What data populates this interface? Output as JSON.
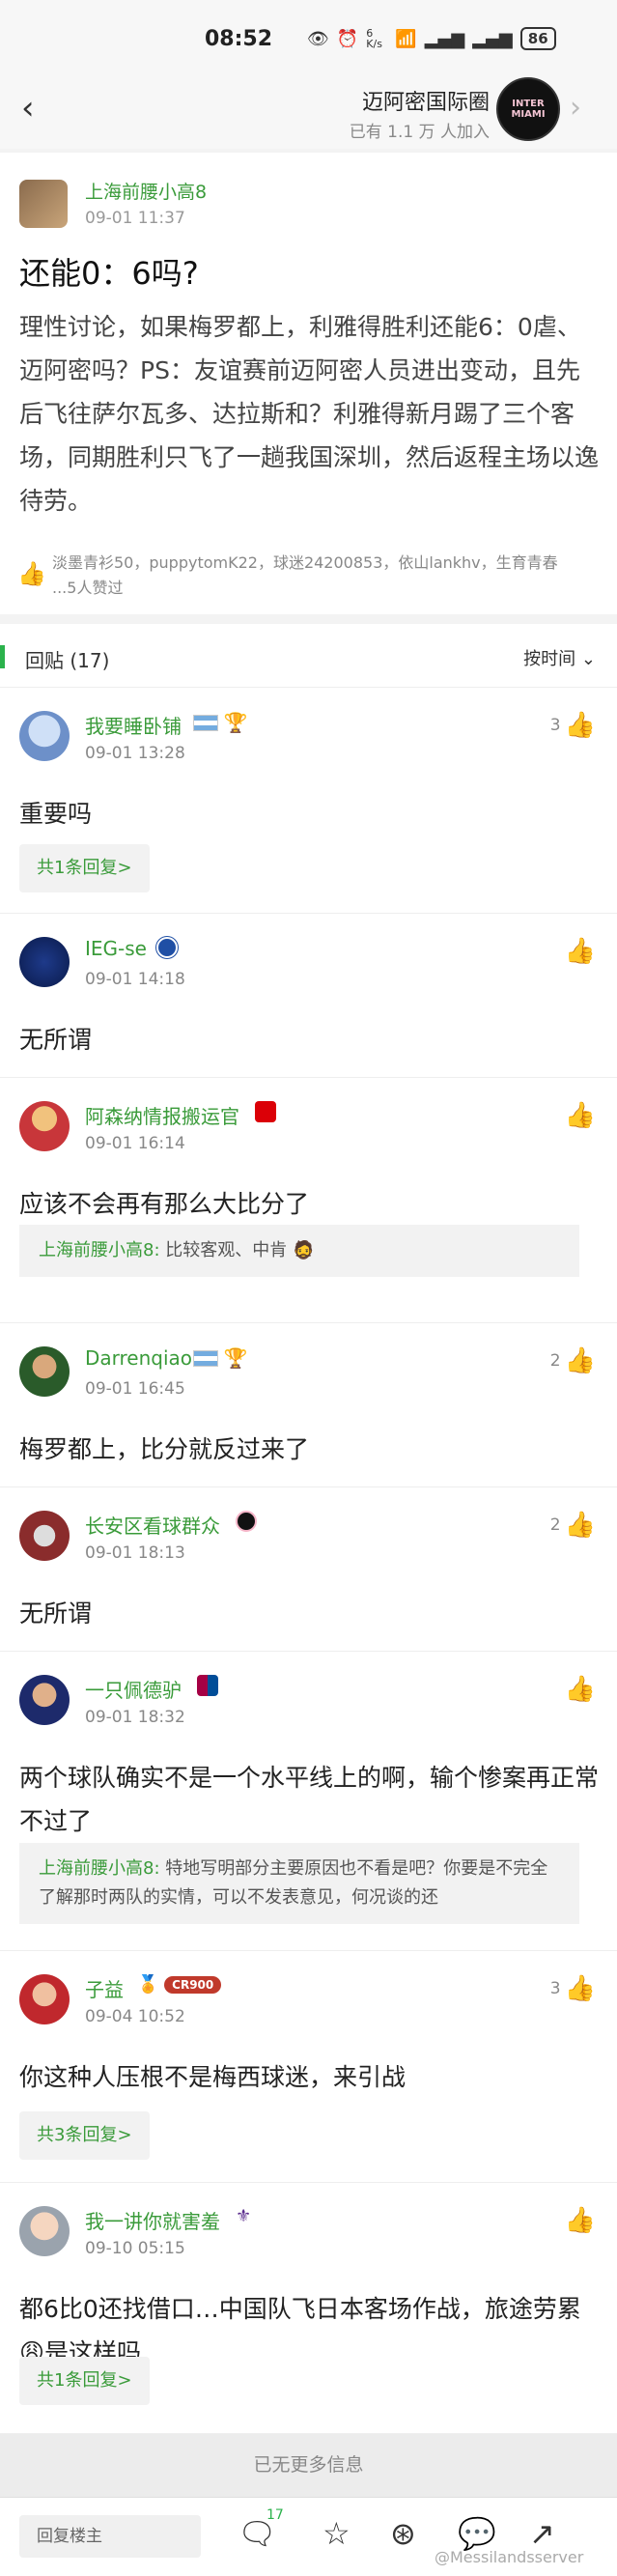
{
  "status_bar": {
    "time": "08:52",
    "network_speed": "6 K/s",
    "battery": "86"
  },
  "header": {
    "back_icon": "chevron-left-icon",
    "circle_name": "迈阿密国际圈",
    "members": "已有 1.1 万 人加入",
    "logo_text": "INTER MIAMI"
  },
  "post": {
    "author": "上海前腰小高8",
    "time": "09-01 11:37",
    "title": "还能0：6吗?",
    "body": "理性讨论，如果梅罗都上，利雅得胜利还能6：0虐、迈阿密吗？PS：友谊赛前迈阿密人员进出变动，且先后飞往萨尔瓦多、达拉斯和？利雅得新月踢了三个客场，同期胜利只飞了一趟我国深圳，然后返程主场以逸待劳。",
    "likes": "淡墨青衫50，puppytomK22，球迷24200853，依山lankhv，生育青春 ...5人赞过"
  },
  "replies_header": {
    "count_label": "回贴 (17)",
    "sort_label": "按时间"
  },
  "replies": [
    {
      "name": "我要睡卧铺",
      "time": "09-01 13:28",
      "likes": "3",
      "text": "重要吗",
      "sub": "共1条回复>"
    },
    {
      "name": "IEG-se",
      "time": "09-01 14:18",
      "likes": "",
      "text": "无所谓"
    },
    {
      "name": "阿森纳情报搬运官",
      "time": "09-01 16:14",
      "likes": "",
      "text": "应该不会再有那么大比分了",
      "quote_name": "上海前腰小高8:",
      "quote_text": " 比较客观、中肯"
    },
    {
      "name": "Darrenqiao",
      "time": "09-01 16:45",
      "likes": "2",
      "text": "梅罗都上，比分就反过来了"
    },
    {
      "name": "长安区看球群众",
      "time": "09-01 18:13",
      "likes": "2",
      "text": "无所谓"
    },
    {
      "name": "一只佩德驴",
      "time": "09-01 18:32",
      "likes": "",
      "text": "两个球队确实不是一个水平线上的啊，输个惨案再正常不过了",
      "quote_name": "上海前腰小高8:",
      "quote_text": " 特地写明部分主要原因也不看是吧？你要是不完全了解那时两队的实情，可以不发表意见，何况谈的还"
    },
    {
      "name": "子益",
      "time": "09-04 10:52",
      "likes": "3",
      "text": "你这种人压根不是梅西球迷，来引战",
      "badge": "CR900",
      "sub": "共3条回复>"
    },
    {
      "name": "我一讲你就害羞",
      "time": "09-10 05:15",
      "likes": "",
      "text": "都6比0还找借口…中国队飞日本客场作战，旅途劳累😩是这样吗",
      "sub": "共1条回复>"
    }
  ],
  "footer_note": "已无更多信息",
  "bottom_bar": {
    "reply_placeholder": "回复楼主",
    "comment_count": "17",
    "watermark": "@Messilandsserver"
  },
  "colors": {
    "accent_green": "#3a9b3a",
    "bar_green": "#2bb24c"
  }
}
